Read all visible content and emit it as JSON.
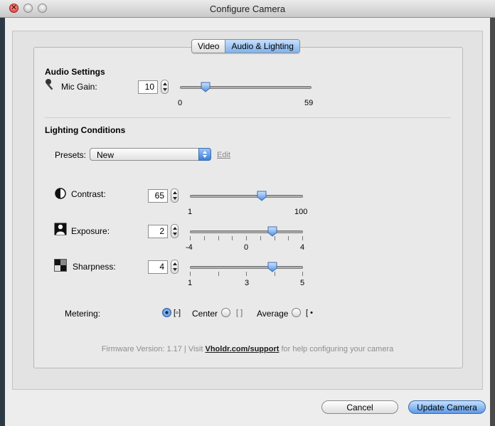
{
  "window": {
    "title": "Configure Camera"
  },
  "tabs": [
    {
      "label": "Video",
      "active": false
    },
    {
      "label": "Audio & Lighting",
      "active": true
    }
  ],
  "audio": {
    "section_title": "Audio Settings",
    "mic_gain": {
      "label": "Mic Gain:",
      "value": "10",
      "min_label": "0",
      "max_label": "59",
      "min": 0,
      "max": 59,
      "level": 10
    }
  },
  "lighting": {
    "section_title": "Lighting Conditions",
    "presets": {
      "label": "Presets:",
      "selected": "New",
      "edit_label": "Edit"
    },
    "contrast": {
      "label": "Contrast:",
      "value": "65",
      "min_label": "1",
      "max_label": "100",
      "min": 1,
      "max": 100,
      "level": 65
    },
    "exposure": {
      "label": "Exposure:",
      "value": "2",
      "tick_labels": [
        "-4",
        "0",
        "4"
      ],
      "min": -4,
      "max": 4,
      "level": 2
    },
    "sharpness": {
      "label": "Sharpness:",
      "value": "4",
      "tick_labels": [
        "1",
        "3",
        "5"
      ],
      "min": 1,
      "max": 5,
      "level": 4
    }
  },
  "metering": {
    "label": "Metering:",
    "options": [
      {
        "label": "Center",
        "selected": true
      },
      {
        "label": "Average",
        "selected": false
      },
      {
        "label": "",
        "selected": false
      }
    ]
  },
  "footer": {
    "firmware_prefix": "Firmware Version: 1.17 | Visit ",
    "link_text": "Vholdr.com/support",
    "suffix": " for help configuring your camera"
  },
  "buttons": {
    "cancel": "Cancel",
    "update": "Update Camera"
  },
  "colors": {
    "accent": "#5c9ae6",
    "thumb": "#4f8fe0"
  }
}
